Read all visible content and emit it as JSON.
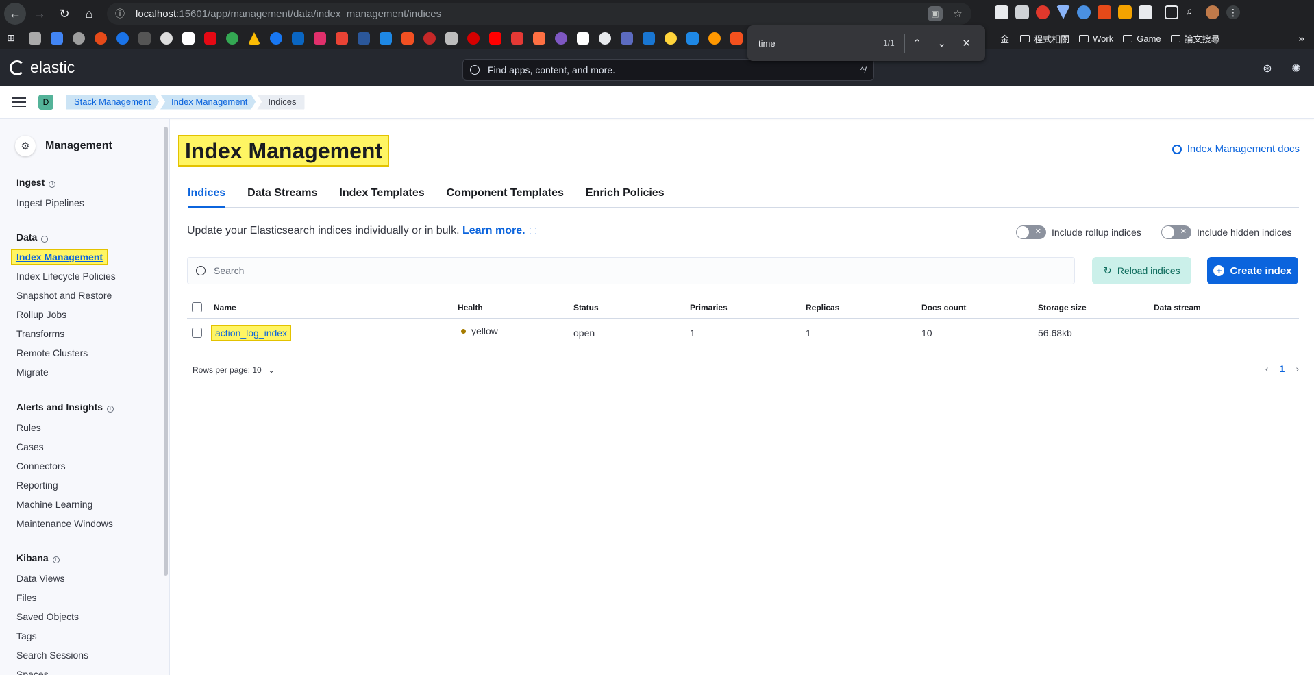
{
  "browser": {
    "url_host": "localhost",
    "url_rest": ":15601/app/management/data/index_management/indices",
    "bookmark_folders": [
      "程式相關",
      "Work",
      "Game",
      "論文搜尋"
    ],
    "partial_text": "金"
  },
  "findbar": {
    "query": "time",
    "count": "1/1"
  },
  "header": {
    "logo_text": "elastic",
    "search_placeholder": "Find apps, content, and more.",
    "search_shortcut": "^/"
  },
  "breadcrumb": {
    "space_initial": "D",
    "items": [
      "Stack Management",
      "Index Management",
      "Indices"
    ]
  },
  "sidebar": {
    "title": "Management",
    "groups": [
      {
        "label": "Ingest",
        "items": [
          "Ingest Pipelines"
        ]
      },
      {
        "label": "Data",
        "items": [
          "Index Management",
          "Index Lifecycle Policies",
          "Snapshot and Restore",
          "Rollup Jobs",
          "Transforms",
          "Remote Clusters",
          "Migrate"
        ]
      },
      {
        "label": "Alerts and Insights",
        "items": [
          "Rules",
          "Cases",
          "Connectors",
          "Reporting",
          "Machine Learning",
          "Maintenance Windows"
        ]
      },
      {
        "label": "Kibana",
        "items": [
          "Data Views",
          "Files",
          "Saved Objects",
          "Tags",
          "Search Sessions",
          "Spaces"
        ]
      }
    ]
  },
  "main": {
    "title": "Index Management",
    "docs_link": "Index Management docs",
    "tabs": [
      "Indices",
      "Data Streams",
      "Index Templates",
      "Component Templates",
      "Enrich Policies"
    ],
    "description": "Update your Elasticsearch indices individually or in bulk.",
    "learn_more": "Learn more.",
    "toggle_rollup": "Include rollup indices",
    "toggle_hidden": "Include hidden indices",
    "search_placeholder": "Search",
    "reload_label": "Reload indices",
    "create_label": "Create index",
    "table": {
      "columns": [
        "Name",
        "Health",
        "Status",
        "Primaries",
        "Replicas",
        "Docs count",
        "Storage size",
        "Data stream"
      ],
      "rows": [
        {
          "name": "action_log_index",
          "health": "yellow",
          "status": "open",
          "primaries": "1",
          "replicas": "1",
          "docs_count": "10",
          "storage_size": "56.68kb",
          "data_stream": ""
        }
      ]
    },
    "rows_per_page": "Rows per page: 10",
    "page": "1"
  },
  "colors": {
    "accent": "#0b64dd",
    "highlight": "#fff563",
    "health_yellow": "#a67c00"
  }
}
